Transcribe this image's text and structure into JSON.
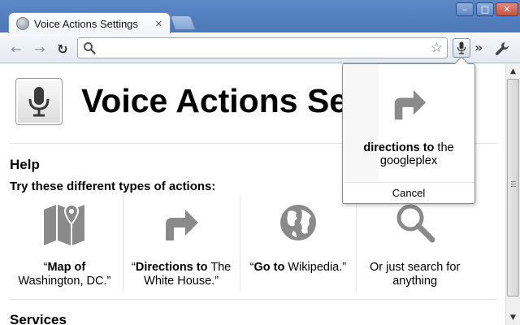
{
  "window": {
    "minimize_glyph": "–",
    "maximize_glyph": "□",
    "close_glyph": "✕"
  },
  "tab": {
    "title": "Voice Actions Settings",
    "close_glyph": "✕"
  },
  "toolbar": {
    "back_glyph": "←",
    "forward_glyph": "→",
    "reload_glyph": "↻",
    "address_value": "",
    "address_placeholder": "",
    "star_glyph": "☆",
    "overflow_glyph": "»"
  },
  "page": {
    "title": "Voice Actions Settings",
    "help_heading": "Help",
    "help_subheading": "Try these different types of actions:",
    "actions": [
      {
        "icon": "map-icon",
        "quote_open": "“",
        "bold": "Map of",
        "rest": " Washington, DC.",
        "quote_close": "”"
      },
      {
        "icon": "directions-arrow-icon",
        "quote_open": "“",
        "bold": "Directions to",
        "rest": " The White House.",
        "quote_close": "”"
      },
      {
        "icon": "globe-icon",
        "quote_open": "“",
        "bold": "Go to",
        "rest": " Wikipedia.",
        "quote_close": "”"
      },
      {
        "icon": "search-magnifier-icon",
        "quote_open": "",
        "bold": "",
        "rest": "Or just search for anything",
        "quote_close": ""
      }
    ],
    "services_heading": "Services"
  },
  "popup": {
    "icon": "directions-arrow-icon",
    "bold": "directions to",
    "rest": " the googleplex",
    "cancel_label": "Cancel"
  },
  "colors": {
    "titlebar": "#5d88c6",
    "icon_gray": "#8a8a8a"
  }
}
